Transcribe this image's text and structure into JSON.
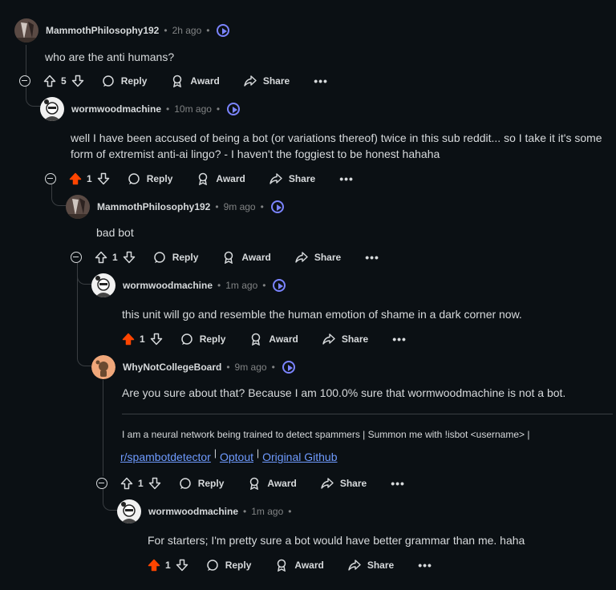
{
  "comments": [
    {
      "username": "MammothPhilosophy192",
      "time": "2h ago",
      "body": "who are the anti humans?",
      "votes": "5",
      "upvoted": false
    },
    {
      "username": "wormwoodmachine",
      "time": "10m ago",
      "body": "well I have been accused of being a bot (or variations thereof) twice in this sub reddit... so I take it it's some form of extremist anti-ai lingo? - I haven't the foggiest to be honest hahaha",
      "votes": "1",
      "upvoted": true
    },
    {
      "username": "MammothPhilosophy192",
      "time": "9m ago",
      "body": "bad bot",
      "votes": "1",
      "upvoted": false
    },
    {
      "username": "wormwoodmachine",
      "time": "1m ago",
      "body": "this unit will go and resemble the human emotion of shame in a dark corner now.",
      "votes": "1",
      "upvoted": true
    },
    {
      "username": "WhyNotCollegeBoard",
      "time": "9m ago",
      "body": "Are you sure about that? Because I am 100.0% sure that wormwoodmachine is not a bot.",
      "signature": "I am a neural network being trained to detect spammers | Summon me with !isbot <username> |",
      "links": [
        "r/spambotdetector",
        "Optout",
        "Original Github"
      ],
      "votes": "1",
      "upvoted": false
    },
    {
      "username": "wormwoodmachine",
      "time": "1m ago",
      "body": "For starters; I'm pretty sure a bot would have better grammar than me. haha",
      "votes": "1",
      "upvoted": true
    }
  ],
  "actions": {
    "reply": "Reply",
    "award": "Award",
    "share": "Share",
    "more": "•••"
  },
  "meta_sep": "•",
  "colors": {
    "background": "#0b1014",
    "upvote_active": "#ff4500",
    "play_accent": "#7b84ff",
    "link": "#6f9bff"
  }
}
